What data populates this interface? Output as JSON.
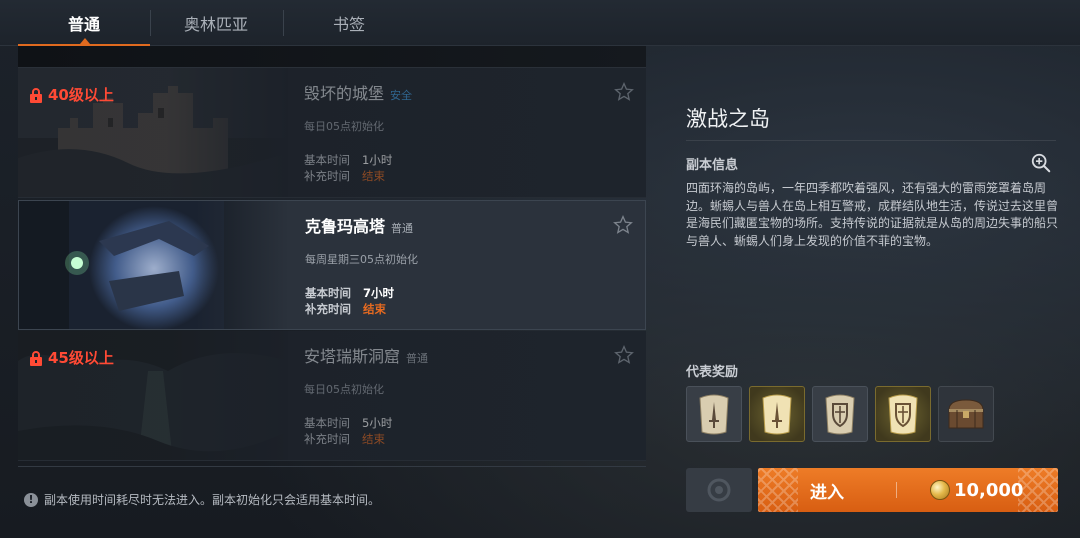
{
  "tabs": [
    {
      "label": "普通",
      "active": true
    },
    {
      "label": "奥林匹亚",
      "active": false
    },
    {
      "label": "书签",
      "active": false
    }
  ],
  "dungeons": [
    {
      "lock_label": "40级以上",
      "title": "毁坏的城堡",
      "tag": "安全",
      "reset": "每日05点初始化",
      "base_time_label": "基本时间",
      "base_time": "1小时",
      "extra_time_label": "补充时间",
      "extra_time": "结束"
    },
    {
      "lock_label": "",
      "title": "克鲁玛高塔",
      "tag": "普通",
      "reset": "每周星期三05点初始化",
      "base_time_label": "基本时间",
      "base_time": "7小时",
      "extra_time_label": "补充时间",
      "extra_time": "结束"
    },
    {
      "lock_label": "45级以上",
      "title": "安塔瑞斯洞窟",
      "tag": "普通",
      "reset": "每日05点初始化",
      "base_time_label": "基本时间",
      "base_time": "5小时",
      "extra_time_label": "补充时间",
      "extra_time": "结束"
    }
  ],
  "notice": "副本使用时间耗尽时无法进入。副本初始化只会适用基本时间。",
  "detail": {
    "title": "激战之岛",
    "info_heading": "副本信息",
    "info_text": "四面环海的岛屿，一年四季都吹着强风，还有强大的雷雨笼罩着岛周边。蜥蜴人与兽人在岛上相互警戒，成群结队地生活，传说过去这里曾是海民们藏匿宝物的场所。支持传说的证据就是从岛的周边失事的船只与兽人、蜥蜴人们身上发现的价值不菲的宝物。",
    "reward_heading": "代表奖励",
    "rewards": [
      {
        "icon": "sword-scroll-icon",
        "tier": "gray"
      },
      {
        "icon": "sword-scroll-icon",
        "tier": "gold"
      },
      {
        "icon": "shield-scroll-icon",
        "tier": "gray"
      },
      {
        "icon": "shield-scroll-icon",
        "tier": "gold"
      },
      {
        "icon": "treasure-chest-icon",
        "tier": "dark"
      }
    ]
  },
  "enter_button": {
    "label": "进入",
    "cost": "10,000",
    "currency_icon": "adena-coin-icon"
  },
  "colors": {
    "accent": "#e06a1f",
    "locked": "#ff4a35",
    "ended": "#e66a20",
    "safe_tag": "#3e9be0"
  }
}
